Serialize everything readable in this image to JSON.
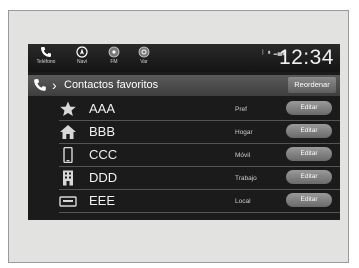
{
  "statusbar": {
    "buttons": [
      {
        "label": "Teléfono",
        "icon": "phone-icon"
      },
      {
        "label": "Navi",
        "icon": "navigation-icon"
      },
      {
        "label": "FM",
        "icon": "radio-icon"
      },
      {
        "label": "Var",
        "icon": "settings-icon"
      }
    ],
    "clock": "12:34"
  },
  "header": {
    "title": "Contactos favoritos",
    "reorder_label": "Reordenar",
    "icon": "phone-icon"
  },
  "contacts": [
    {
      "name": "AAA",
      "type": "Pref",
      "edit_label": "Editar",
      "icon": "star-icon"
    },
    {
      "name": "BBB",
      "type": "Hogar",
      "edit_label": "Editar",
      "icon": "home-icon"
    },
    {
      "name": "CCC",
      "type": "Móvil",
      "edit_label": "Editar",
      "icon": "mobile-phone-icon"
    },
    {
      "name": "DDD",
      "type": "Trabajo",
      "edit_label": "Editar",
      "icon": "work-building-icon"
    },
    {
      "name": "EEE",
      "type": "Local",
      "edit_label": "Editar",
      "icon": "landline-icon"
    }
  ],
  "colors": {
    "screen_bg": "#1b1b1b",
    "header_bg": "#4a4a4a",
    "button_bg": "#808080",
    "text": "#ffffff",
    "frame_bg": "#e2e2e1"
  }
}
